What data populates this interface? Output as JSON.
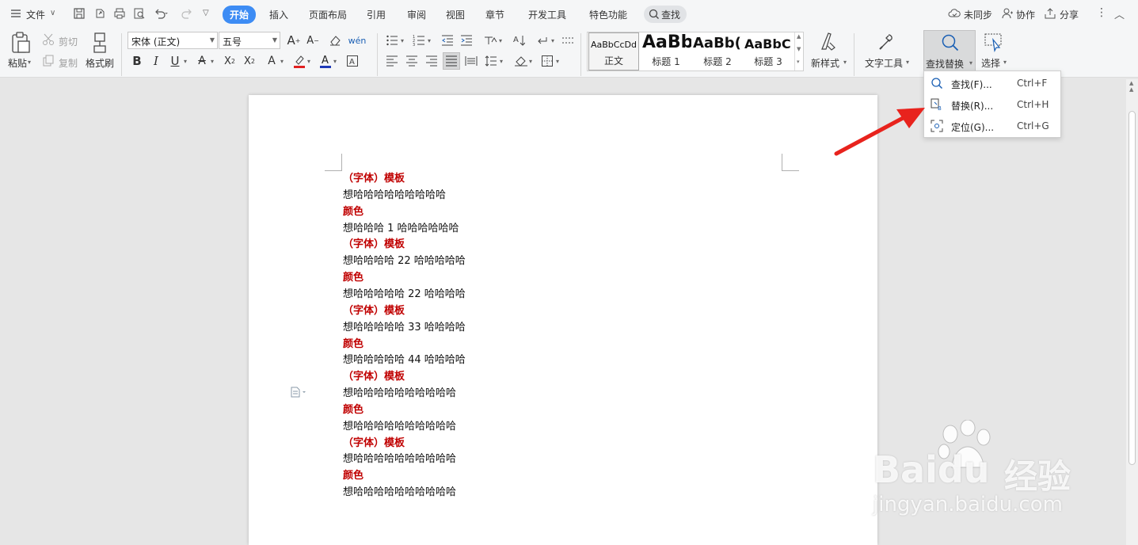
{
  "menubar": {
    "file_label": "文件",
    "tabs": [
      "开始",
      "插入",
      "页面布局",
      "引用",
      "审阅",
      "视图",
      "章节",
      "开发工具",
      "特色功能"
    ],
    "search_label": "查找",
    "unsync_label": "未同步",
    "collab_label": "协作",
    "share_label": "分享"
  },
  "ribbon": {
    "paste_label": "粘贴",
    "cut_label": "剪切",
    "copy_label": "复制",
    "format_painter_label": "格式刷",
    "font_name": "宋体 (正文)",
    "font_size": "五号",
    "styles": [
      {
        "sample": "AaBbCcDd",
        "name": "正文"
      },
      {
        "sample": "AaBb",
        "name": "标题 1"
      },
      {
        "sample": "AaBb(",
        "name": "标题 2"
      },
      {
        "sample": "AaBbC",
        "name": "标题 3"
      }
    ],
    "new_style_label": "新样式",
    "text_tools_label": "文字工具",
    "find_replace_label": "查找替换",
    "select_label": "选择"
  },
  "dropdown": {
    "items": [
      {
        "label": "查找(F)...",
        "shortcut": "Ctrl+F",
        "icon": "search-icon"
      },
      {
        "label": "替换(R)...",
        "shortcut": "Ctrl+H",
        "icon": "replace-icon"
      },
      {
        "label": "定位(G)...",
        "shortcut": "Ctrl+G",
        "icon": "goto-icon"
      }
    ]
  },
  "document": {
    "lines": [
      {
        "text": "（字体）模板",
        "type": "head"
      },
      {
        "text": "想哈哈哈哈哈哈哈哈哈",
        "type": "body"
      },
      {
        "text": "颜色",
        "type": "head"
      },
      {
        "text": "想哈哈哈 1 哈哈哈哈哈哈",
        "type": "body"
      },
      {
        "text": "（字体）模板",
        "type": "head"
      },
      {
        "text": "想哈哈哈哈 22 哈哈哈哈哈",
        "type": "body"
      },
      {
        "text": "颜色",
        "type": "head"
      },
      {
        "text": "想哈哈哈哈哈 22 哈哈哈哈",
        "type": "body"
      },
      {
        "text": "（字体）模板",
        "type": "head"
      },
      {
        "text": "想哈哈哈哈哈 33 哈哈哈哈",
        "type": "body"
      },
      {
        "text": "颜色",
        "type": "head"
      },
      {
        "text": "想哈哈哈哈哈 44 哈哈哈哈",
        "type": "body"
      },
      {
        "text": "（字体）模板",
        "type": "head"
      },
      {
        "text": "想哈哈哈哈哈哈哈哈哈哈",
        "type": "body"
      },
      {
        "text": "颜色",
        "type": "head"
      },
      {
        "text": "想哈哈哈哈哈哈哈哈哈哈",
        "type": "body"
      },
      {
        "text": "（字体）模板",
        "type": "head"
      },
      {
        "text": "想哈哈哈哈哈哈哈哈哈哈",
        "type": "body"
      },
      {
        "text": "颜色",
        "type": "head"
      },
      {
        "text": "想哈哈哈哈哈哈哈哈哈哈",
        "type": "body"
      }
    ]
  },
  "watermark": {
    "brand": "Baidu",
    "product": "经验",
    "url": "jingyan.baidu.com"
  },
  "colors": {
    "accent": "#3d8cf4",
    "heading_red": "#c00000",
    "arrow_red": "#e8231d",
    "font_color_blue": "#1f3ab8",
    "highlight_red": "#e02020"
  }
}
